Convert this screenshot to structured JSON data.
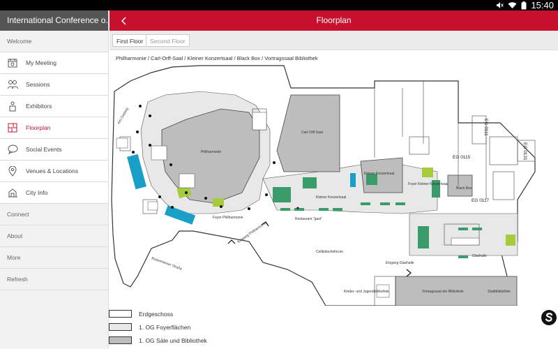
{
  "status": {
    "time": "15:40"
  },
  "sidebar": {
    "title": "International Conference o...",
    "sections": {
      "welcome": "Welcome",
      "connect": "Connect",
      "about": "About",
      "more": "More",
      "refresh": "Refresh"
    },
    "items": [
      {
        "label": "My Meeting",
        "icon": "calendar-icon"
      },
      {
        "label": "Sessions",
        "icon": "people-icon"
      },
      {
        "label": "Exhibitors",
        "icon": "exhibitor-icon"
      },
      {
        "label": "Floorplan",
        "icon": "floorplan-icon",
        "active": true
      },
      {
        "label": "Social Events",
        "icon": "chat-bubble-icon"
      },
      {
        "label": "Venues & Locations",
        "icon": "location-pin-icon"
      },
      {
        "label": "City Info",
        "icon": "city-icon"
      }
    ]
  },
  "header": {
    "title": "Floorplan"
  },
  "tabs": [
    {
      "label": "First Floor",
      "selected": true
    },
    {
      "label": "Second Floor",
      "selected": false
    }
  ],
  "map": {
    "subtitle": "Philharmonie / Carl-Orff-Saal / Kleiner Konzertsaal / Black Box / Vortragssaal Bibliothek",
    "labels": {
      "philharmonie": "Philharmonie",
      "carl_orff": "Carl-Orff-Saal",
      "kleiner": "Kleiner Konzertsaal",
      "foyer_phil": "Foyer Philharmonie",
      "foyer_kleiner": "Foyer Kleiner Konzertsaal",
      "kleiner_konzertsaal_2": "Kleiner Konzertsaal",
      "black_box": "Black Box",
      "eg_0115": "EG 0115",
      "eg_0117": "EG 0117",
      "eg_0111": "EG 0111",
      "eg_0131": "EG 0131",
      "restaurant": "Restaurant \"gast\"",
      "glashalle": "Glashalle",
      "celibidache": "Celibidacheforum",
      "eingang_glashalle": "Eingang Glashalle",
      "eingang_phil": "Eingang Philharmonie",
      "vortragssaal": "Vortragssaal der Bibliothek",
      "stadtbibliothek": "Stadtbibliothek",
      "kinder": "Kinder- und Jugendbibliothek",
      "am_gasteig": "Am Gasteig",
      "rosenheimer": "Rosenheimer Straße"
    }
  },
  "legend": [
    {
      "label": "Erdgeschoss",
      "color": "#ffffff"
    },
    {
      "label": "1. OG Foyerflächen",
      "color": "#e8e8e8"
    },
    {
      "label": "1. OG Säle und Bibliothek",
      "color": "#bdbdbd"
    }
  ],
  "colors": {
    "accent": "#c8102e",
    "blue": "#1aa0c8",
    "green_dark": "#3a9b6b",
    "green_light": "#a6cc3c"
  }
}
